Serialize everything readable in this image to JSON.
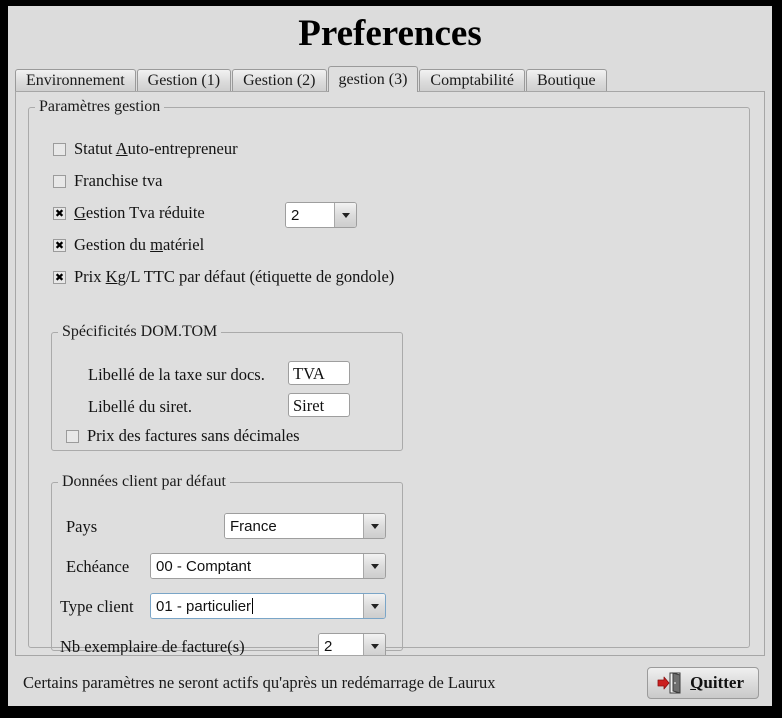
{
  "window": {
    "title": "Preferences",
    "background_color": "#dcdcdc",
    "frame_color": "#000000"
  },
  "tabs": [
    {
      "label": "Environnement",
      "active": false
    },
    {
      "label": "Gestion (1)",
      "active": false
    },
    {
      "label": "Gestion (2)",
      "active": false
    },
    {
      "label": "gestion (3)",
      "active": true
    },
    {
      "label": "Comptabilité",
      "active": false
    },
    {
      "label": "Boutique",
      "active": false
    }
  ],
  "params_group": {
    "legend": "Paramètres gestion",
    "checkboxes": [
      {
        "label_before": "Statut ",
        "mnemonic": "A",
        "label_after": "uto-entrepreneur",
        "checked": false
      },
      {
        "label_before": "Franchise tva",
        "mnemonic": "",
        "label_after": "",
        "checked": false
      },
      {
        "label_before": "",
        "mnemonic": "G",
        "label_after": "estion Tva réduite",
        "checked": true
      },
      {
        "label_before": "Gestion du ",
        "mnemonic": "m",
        "label_after": "atériel",
        "checked": true
      },
      {
        "label_before": "Prix ",
        "mnemonic": "K",
        "label_after": "g/L TTC par défaut (étiquette de gondole)",
        "checked": true
      }
    ],
    "tva_reduite_value": "2"
  },
  "domtom_group": {
    "legend": "Spécificités DOM.TOM",
    "taxe_label": "Libellé de la taxe sur docs.",
    "taxe_value": "TVA",
    "siret_label": "Libellé du siret.",
    "siret_value": "Siret",
    "sans_decimales_label": "Prix des factures sans décimales",
    "sans_decimales_checked": false
  },
  "client_group": {
    "legend": "Données client par défaut",
    "pays_label": "Pays",
    "pays_value": "France",
    "echeance_label": "Echéance",
    "echeance_value": "00 - Comptant",
    "type_client_label": "Type client",
    "type_client_value": "01 - particulier",
    "nb_exemplaire_label": "Nb exemplaire de facture(s)",
    "nb_exemplaire_value": "2"
  },
  "footer": {
    "status": "Certains paramètres ne seront actifs qu'après un redémarrage de Laurux",
    "quit_label": "Quitter",
    "quit_mnemonic": "Q",
    "quit_icon": "exit-door-icon",
    "quit_icon_arrow_color": "#cc2020"
  }
}
